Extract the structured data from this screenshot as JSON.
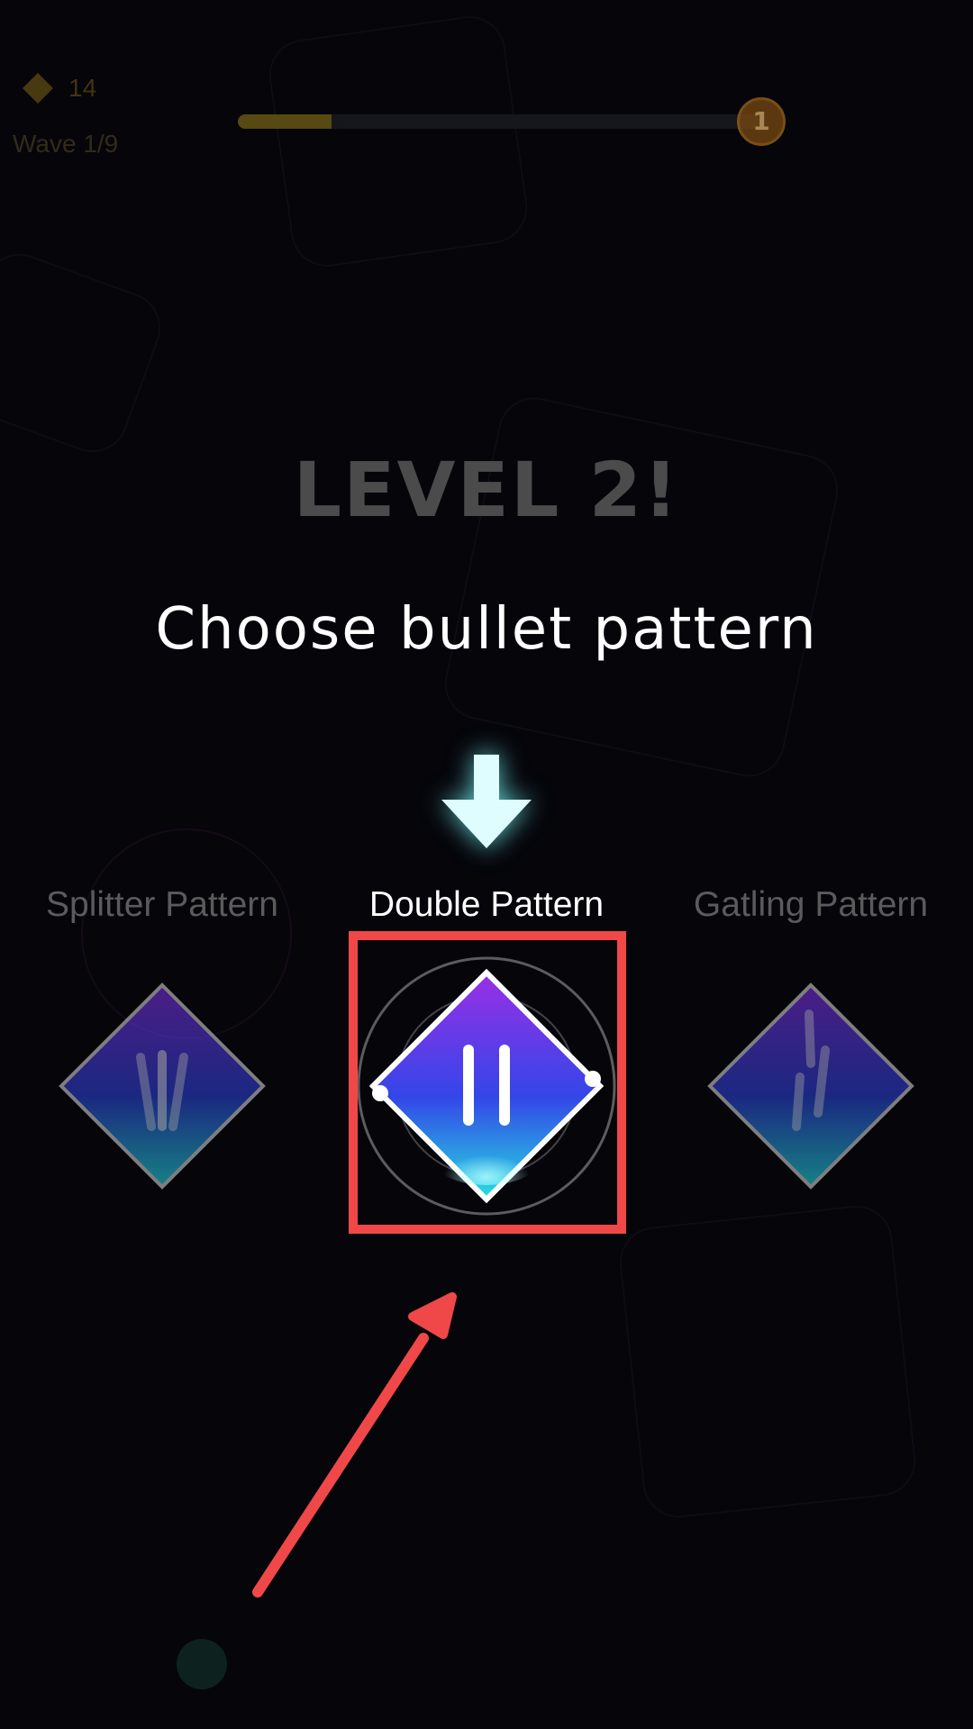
{
  "hud": {
    "coins": "14",
    "wave": "Wave 1/9",
    "level_badge": "1",
    "xp_progress_percent": 18
  },
  "title": "LEVEL 2!",
  "subtitle": "Choose bullet pattern",
  "options": [
    {
      "label": "Splitter Pattern",
      "icon": "splitter-pattern-icon",
      "selected": false
    },
    {
      "label": "Double Pattern",
      "icon": "double-pattern-icon",
      "selected": true
    },
    {
      "label": "Gatling Pattern",
      "icon": "gatling-pattern-icon",
      "selected": false
    }
  ],
  "colors": {
    "highlight": "#f04848",
    "card_top": "#7b2fd9",
    "card_bottom": "#22d6d6",
    "arrow": "#dffcff"
  }
}
